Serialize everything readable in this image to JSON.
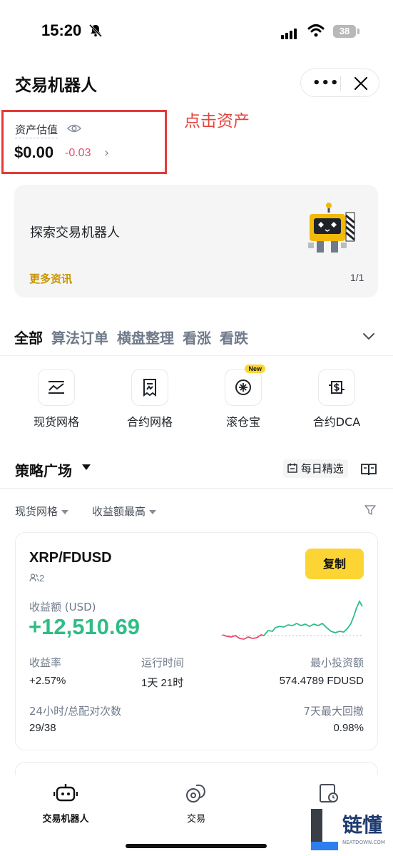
{
  "status_bar": {
    "time": "15:20",
    "battery": "38"
  },
  "header": {
    "title": "交易机器人",
    "more_label": "•••"
  },
  "asset": {
    "label": "资产估值",
    "value": "$0.00",
    "change": "-0.03"
  },
  "annotation": "点击资产",
  "banner": {
    "title": "探索交易机器人",
    "link": "更多资讯",
    "page": "1/1"
  },
  "tabs": [
    "全部",
    "算法订单",
    "横盘整理",
    "看涨",
    "看跌"
  ],
  "strategies": [
    {
      "label": "现货网格",
      "icon": "spot-grid-icon"
    },
    {
      "label": "合约网格",
      "icon": "futures-grid-icon"
    },
    {
      "label": "滚仓宝",
      "icon": "rollover-icon",
      "badge": "New"
    },
    {
      "label": "合约DCA",
      "icon": "futures-dca-icon"
    }
  ],
  "square": {
    "title": "策略广场",
    "daily": "每日精选"
  },
  "filters": {
    "type": "现货网格",
    "sort": "收益额最高"
  },
  "card": {
    "pair": "XRP/FDUSD",
    "copiers": "2",
    "copy_label": "复制",
    "pnl_label": "收益额 (USD)",
    "pnl_value": "+12,510.69",
    "roi_label": "收益率",
    "roi_value": "+2.57%",
    "runtime_label": "运行时间",
    "runtime_value": "1天 21时",
    "min_label": "最小投资额",
    "min_value": "574.4789 FDUSD",
    "matches_label": "24小时/总配对次数",
    "matches_value": "29/38",
    "drawdown_label": "7天最大回撤",
    "drawdown_value": "0.98%"
  },
  "nav": {
    "bots": "交易机器人",
    "trade": "交易"
  },
  "watermark": {
    "text": "链懂",
    "sub": "NEATDOWN.COM"
  },
  "colors": {
    "brand_yellow": "#fcd535",
    "profit_green": "#2ebd85",
    "loss_red": "#e44b6c",
    "annotation_red": "#e43a3a"
  }
}
